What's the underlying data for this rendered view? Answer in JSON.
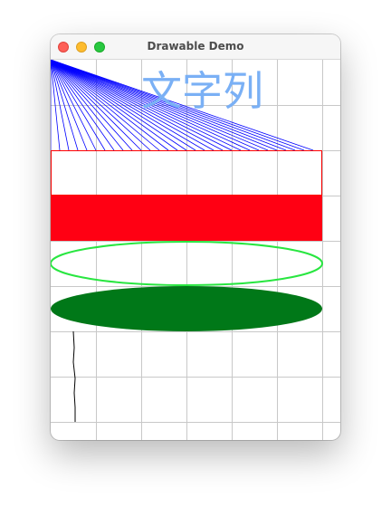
{
  "window": {
    "title": "Drawable Demo"
  },
  "canvas": {
    "text": "文字列",
    "colors": {
      "grid": "#c8c8c8",
      "fan_lines": "#0000ff",
      "text": "#7ab0f5",
      "rect_outline": "#ff0000",
      "rect_fill": "#ff0013",
      "ellipse_outline": "#28e640",
      "ellipse_fill": "#007818",
      "squiggle": "#000000"
    }
  }
}
